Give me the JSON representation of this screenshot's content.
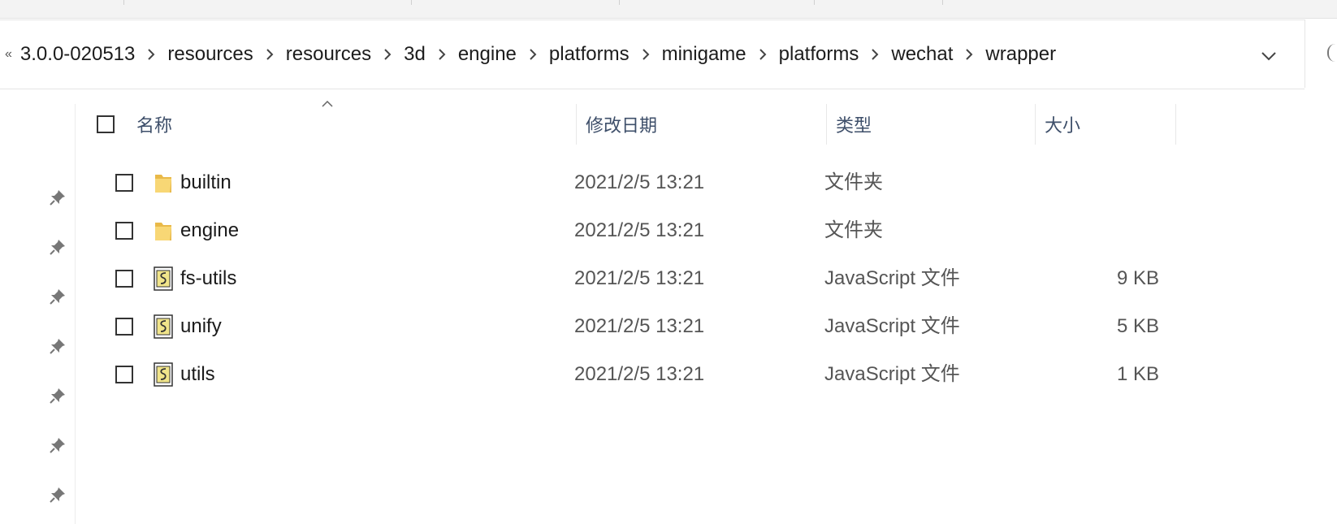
{
  "breadcrumb": {
    "overflow_glyph": "«",
    "items": [
      "3.0.0-020513",
      "resources",
      "resources",
      "3d",
      "engine",
      "platforms",
      "minigame",
      "platforms",
      "wechat",
      "wrapper"
    ]
  },
  "columns": {
    "name": "名称",
    "modified": "修改日期",
    "type": "类型",
    "size": "大小"
  },
  "files": [
    {
      "name": "builtin",
      "date": "2021/2/5 13:21",
      "type": "文件夹",
      "size": "",
      "icon": "folder-icon"
    },
    {
      "name": "engine",
      "date": "2021/2/5 13:21",
      "type": "文件夹",
      "size": "",
      "icon": "folder-icon"
    },
    {
      "name": "fs-utils",
      "date": "2021/2/5 13:21",
      "type": "JavaScript 文件",
      "size": "9 KB",
      "icon": "javascript-file-icon"
    },
    {
      "name": "unify",
      "date": "2021/2/5 13:21",
      "type": "JavaScript 文件",
      "size": "5 KB",
      "icon": "javascript-file-icon"
    },
    {
      "name": "utils",
      "date": "2021/2/5 13:21",
      "type": "JavaScript 文件",
      "size": "1 KB",
      "icon": "javascript-file-icon"
    }
  ],
  "colors": {
    "header_text": "#3e4f6a",
    "folder": "#f8d775",
    "script_icon": "#f0e48a"
  }
}
